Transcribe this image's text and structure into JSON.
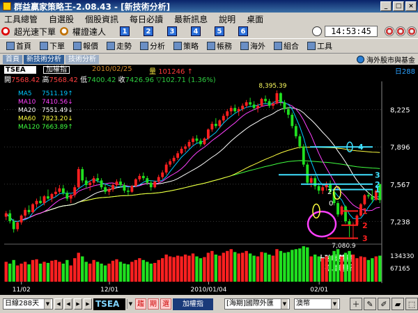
{
  "window": {
    "title": "群益贏家策略王-2.08.43 - [新技術分析]",
    "controls": [
      "_",
      "□",
      "×"
    ]
  },
  "menu": [
    "工具總管",
    "自選股",
    "個股資訊",
    "每日必讀",
    "最新訊息",
    "說明",
    "桌面"
  ],
  "toolbar1": {
    "items": [
      "超光速下單",
      "權證達人"
    ],
    "numbers": [
      "1",
      "2",
      "3",
      "4",
      "5",
      "6"
    ],
    "clock": "14:53:45"
  },
  "toolbar2": [
    "首頁",
    "下單",
    "報價",
    "走勢",
    "分析",
    "策略",
    "帳務",
    "海外",
    "組合",
    "工具"
  ],
  "tabs": [
    "首頁",
    "新技術分析",
    "技術分析"
  ],
  "overseas_link": "海外股市與基金",
  "info": {
    "symbol": "TSEA",
    "index_label": "加權指",
    "date": "2010/02/25",
    "volume_label": "量",
    "volume_value": "101246",
    "days": "日288",
    "open_label": "開",
    "open": "7568.42",
    "high_label": "高",
    "high": "7568.42",
    "low_label": "低",
    "low": "7400.42",
    "close_label": "收",
    "close": "7426.96",
    "change": "▽102.71 (1.36%)"
  },
  "ma_legend": [
    {
      "name": "MA5",
      "value": "7511.19",
      "arrow": "↑",
      "color": "#00c8ff"
    },
    {
      "name": "MA10",
      "value": "7410.56",
      "arrow": "↓",
      "color": "#ff40ff"
    },
    {
      "name": "MA20",
      "value": "7551.49",
      "arrow": "↓",
      "color": "#ffffff"
    },
    {
      "name": "MA60",
      "value": "7823.20",
      "arrow": "↓",
      "color": "#ffff40"
    },
    {
      "name": "MA120",
      "value": "7663.89",
      "arrow": "↑",
      "color": "#40ff40"
    }
  ],
  "chart_data": {
    "type": "candlestick",
    "y_ticks": [
      "8,225",
      "7,896",
      "7,567",
      "7,238"
    ],
    "volume_ticks": [
      "134330",
      "67165"
    ],
    "x_ticks": [
      "11/02",
      "12/01",
      "2010/01/04",
      "02/01"
    ],
    "peak_label": "8,395.39",
    "trough_label": "7,080.9",
    "annotations": {
      "right_numbers": [
        "4",
        "3",
        "2",
        "1"
      ],
      "red_numbers": [
        "1",
        "2",
        "3"
      ],
      "circle_labels": [
        "2",
        "0"
      ],
      "note_line1": "十破喉雙星",
      "note_line2": "孤島轉折"
    },
    "candles": [
      [
        7280,
        7330,
        7250,
        7310
      ],
      [
        7310,
        7340,
        7220,
        7240
      ],
      [
        7240,
        7260,
        7140,
        7170
      ],
      [
        7170,
        7240,
        7150,
        7230
      ],
      [
        7230,
        7300,
        7210,
        7290
      ],
      [
        7290,
        7360,
        7270,
        7340
      ],
      [
        7340,
        7380,
        7300,
        7320
      ],
      [
        7320,
        7400,
        7310,
        7390
      ],
      [
        7390,
        7440,
        7360,
        7420
      ],
      [
        7420,
        7460,
        7390,
        7400
      ],
      [
        7400,
        7470,
        7380,
        7460
      ],
      [
        7460,
        7520,
        7430,
        7440
      ],
      [
        7440,
        7490,
        7410,
        7480
      ],
      [
        7480,
        7540,
        7460,
        7500
      ],
      [
        7500,
        7560,
        7480,
        7530
      ],
      [
        7530,
        7560,
        7470,
        7490
      ],
      [
        7490,
        7510,
        7420,
        7440
      ],
      [
        7440,
        7480,
        7400,
        7470
      ],
      [
        7470,
        7560,
        7450,
        7540
      ],
      [
        7540,
        7720,
        7530,
        7700
      ],
      [
        7700,
        7720,
        7580,
        7600
      ],
      [
        7600,
        7630,
        7530,
        7560
      ],
      [
        7560,
        7600,
        7510,
        7580
      ],
      [
        7580,
        7640,
        7550,
        7620
      ],
      [
        7620,
        7660,
        7580,
        7600
      ],
      [
        7600,
        7620,
        7520,
        7540
      ],
      [
        7540,
        7570,
        7480,
        7500
      ],
      [
        7500,
        7540,
        7470,
        7520
      ],
      [
        7520,
        7580,
        7500,
        7560
      ],
      [
        7560,
        7610,
        7540,
        7590
      ],
      [
        7590,
        7620,
        7540,
        7560
      ],
      [
        7560,
        7580,
        7490,
        7510
      ],
      [
        7510,
        7540,
        7470,
        7500
      ],
      [
        7500,
        7560,
        7490,
        7550
      ],
      [
        7550,
        7620,
        7540,
        7610
      ],
      [
        7610,
        7660,
        7590,
        7640
      ],
      [
        7640,
        7670,
        7600,
        7620
      ],
      [
        7620,
        7640,
        7560,
        7580
      ],
      [
        7580,
        7600,
        7510,
        7540
      ],
      [
        7540,
        7600,
        7530,
        7590
      ],
      [
        7590,
        7650,
        7580,
        7630
      ],
      [
        7630,
        7690,
        7610,
        7670
      ],
      [
        7670,
        7760,
        7650,
        7740
      ],
      [
        7740,
        7790,
        7720,
        7770
      ],
      [
        7770,
        7820,
        7750,
        7800
      ],
      [
        7800,
        7860,
        7780,
        7840
      ],
      [
        7840,
        7900,
        7830,
        7880
      ],
      [
        7880,
        7920,
        7850,
        7900
      ],
      [
        7900,
        7960,
        7880,
        7940
      ],
      [
        7940,
        7990,
        7910,
        7970
      ],
      [
        7970,
        8000,
        7930,
        7950
      ],
      [
        7950,
        7970,
        7900,
        7920
      ],
      [
        7920,
        7980,
        7910,
        7970
      ],
      [
        7970,
        8060,
        7960,
        8050
      ],
      [
        8050,
        8120,
        8030,
        8100
      ],
      [
        8100,
        8150,
        8060,
        8080
      ],
      [
        8080,
        8140,
        8060,
        8130
      ],
      [
        8130,
        8190,
        8110,
        8170
      ],
      [
        8170,
        8230,
        8140,
        8210
      ],
      [
        8210,
        8260,
        8180,
        8240
      ],
      [
        8240,
        8270,
        8190,
        8210
      ],
      [
        8210,
        8250,
        8170,
        8230
      ],
      [
        8230,
        8280,
        8210,
        8260
      ],
      [
        8260,
        8310,
        8240,
        8290
      ],
      [
        8290,
        8330,
        8250,
        8270
      ],
      [
        8270,
        8300,
        8220,
        8240
      ],
      [
        8240,
        8280,
        8200,
        8260
      ],
      [
        8260,
        8330,
        8250,
        8320
      ],
      [
        8320,
        8350,
        8280,
        8300
      ],
      [
        8300,
        8320,
        8240,
        8260
      ],
      [
        8260,
        8300,
        8230,
        8280
      ],
      [
        8280,
        8395,
        8270,
        8370
      ],
      [
        8370,
        8380,
        8260,
        8290
      ],
      [
        8290,
        8310,
        8200,
        8230
      ],
      [
        8230,
        8250,
        8150,
        8180
      ],
      [
        8180,
        8200,
        8060,
        8080
      ],
      [
        8080,
        8100,
        7970,
        7990
      ],
      [
        7990,
        8010,
        7880,
        7900
      ],
      [
        7900,
        7920,
        7720,
        7740
      ],
      [
        7740,
        7760,
        7560,
        7580
      ],
      [
        7580,
        7640,
        7540,
        7620
      ],
      [
        7620,
        7640,
        7520,
        7550
      ],
      [
        7550,
        7580,
        7480,
        7510
      ],
      [
        7510,
        7560,
        7480,
        7540
      ],
      [
        7540,
        7590,
        7510,
        7570
      ],
      [
        7570,
        7600,
        7480,
        7500
      ],
      [
        7500,
        7520,
        7380,
        7400
      ],
      [
        7400,
        7420,
        7280,
        7300
      ],
      [
        7300,
        7380,
        7290,
        7370
      ],
      [
        7370,
        7380,
        7220,
        7240
      ],
      [
        7240,
        7260,
        7100,
        7200
      ],
      [
        7200,
        7230,
        7080,
        7210
      ],
      [
        7210,
        7300,
        7200,
        7290
      ],
      [
        7290,
        7400,
        7280,
        7390
      ],
      [
        7390,
        7480,
        7380,
        7470
      ],
      [
        7470,
        7500,
        7440,
        7460
      ],
      [
        7460,
        7520,
        7400,
        7430
      ],
      [
        7430,
        7520,
        7420,
        7510
      ],
      [
        7568,
        7568,
        7400,
        7427
      ]
    ],
    "volumes": [
      0.55,
      0.5,
      0.6,
      0.45,
      0.5,
      0.55,
      0.48,
      0.6,
      0.62,
      0.5,
      0.55,
      0.52,
      0.58,
      0.6,
      0.55,
      0.5,
      0.6,
      0.45,
      0.65,
      0.8,
      0.7,
      0.55,
      0.5,
      0.6,
      0.55,
      0.5,
      0.45,
      0.5,
      0.58,
      0.62,
      0.55,
      0.5,
      0.48,
      0.55,
      0.6,
      0.65,
      0.6,
      0.55,
      0.5,
      0.52,
      0.6,
      0.65,
      0.75,
      0.7,
      0.68,
      0.72,
      0.7,
      0.75,
      0.72,
      0.78,
      0.7,
      0.65,
      0.68,
      0.8,
      0.85,
      0.75,
      0.72,
      0.8,
      0.85,
      0.9,
      0.82,
      0.78,
      0.8,
      0.85,
      0.78,
      0.72,
      0.7,
      0.82,
      0.8,
      0.75,
      0.72,
      0.9,
      0.85,
      0.8,
      0.82,
      0.88,
      0.9,
      0.92,
      0.98,
      0.95,
      0.7,
      0.75,
      0.7,
      0.65,
      0.7,
      0.72,
      0.85,
      0.9,
      0.7,
      0.8,
      0.85,
      0.75,
      0.65,
      0.7,
      0.68,
      0.6,
      0.65,
      0.7,
      0.72
    ]
  },
  "bottombar": {
    "period": "日線288天",
    "symbol": "TSEA",
    "tags": [
      "趨",
      "期",
      "選"
    ],
    "index": "加權指",
    "market": "[海期]國際外匯",
    "extra": "澳幣"
  }
}
